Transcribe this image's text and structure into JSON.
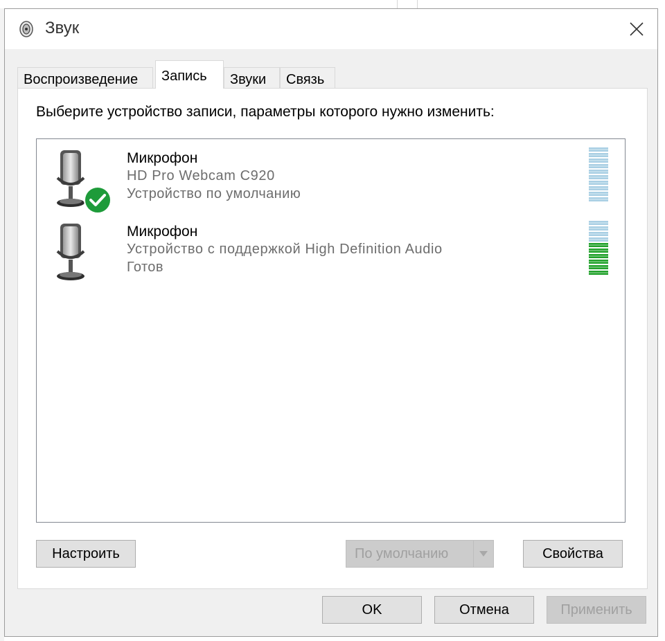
{
  "window": {
    "title": "Звук",
    "close_icon": "close-icon",
    "app_icon": "speaker-icon"
  },
  "tabs": [
    {
      "label": "Воспроизведение",
      "active": false
    },
    {
      "label": "Запись",
      "active": true
    },
    {
      "label": "Звуки",
      "active": false
    },
    {
      "label": "Связь",
      "active": false
    }
  ],
  "instruction": "Выберите устройство записи, параметры которого нужно изменить:",
  "devices": [
    {
      "name": "Микрофон",
      "description": "HD Pro Webcam C920",
      "status": "Устройство по умолчанию",
      "icon": "microphone-icon",
      "badge": "default-checkmark-icon",
      "level": 0.0
    },
    {
      "name": "Микрофон",
      "description": "Устройство с поддержкой High Definition Audio",
      "status": "Готов",
      "icon": "microphone-icon",
      "level": 0.6
    }
  ],
  "buttons": {
    "configure": "Настроить",
    "set_default": "По умолчанию",
    "properties": "Свойства",
    "ok": "OK",
    "cancel": "Отмена",
    "apply": "Применить"
  },
  "colors": {
    "check_green": "#1e9b3a",
    "meter_on": "#22a22c",
    "meter_off": "#a9cfe4"
  }
}
